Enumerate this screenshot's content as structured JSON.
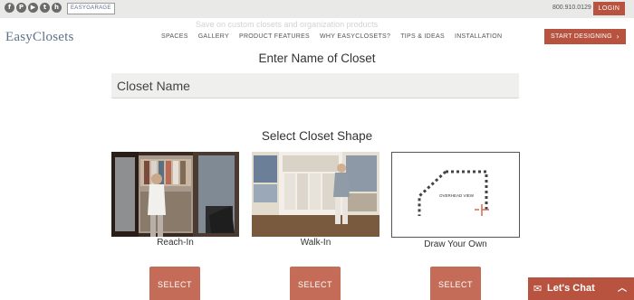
{
  "utility": {
    "social_icons": [
      {
        "name": "facebook-icon",
        "glyph": "f"
      },
      {
        "name": "pinterest-icon",
        "glyph": "P"
      },
      {
        "name": "youtube-icon",
        "glyph": "▶"
      },
      {
        "name": "twitter-icon",
        "glyph": "t"
      },
      {
        "name": "houzz-icon",
        "glyph": "h"
      }
    ],
    "garage_logo": "EASYGARAGE",
    "phone": "800.910.0129",
    "login_label": "LOGIN"
  },
  "promo": {
    "text": "Save on custom closets and organization products"
  },
  "header": {
    "logo": "EasyClosets",
    "nav_items": [
      "SPACES",
      "GALLERY",
      "PRODUCT FEATURES",
      "WHY EASYCLOSETS?",
      "TIPS & IDEAS",
      "INSTALLATION"
    ],
    "cta_label": "START DESIGNING",
    "cta_icon": "chevron-right-icon"
  },
  "form": {
    "name_heading": "Enter Name of Closet",
    "name_placeholder": "Closet Name",
    "shape_heading": "Select Closet Shape",
    "shapes": [
      {
        "label": "Reach-In",
        "select_label": "SELECT"
      },
      {
        "label": "Walk-In",
        "select_label": "SELECT"
      },
      {
        "label": "Draw Your Own",
        "select_label": "SELECT",
        "diagram_caption": "OVERHEAD VIEW"
      }
    ]
  },
  "chat": {
    "label": "Let's Chat",
    "icon": "chat-bubble-icon"
  },
  "colors": {
    "accent": "#b8533f",
    "select_button": "#c46c58",
    "topbar": "#e9e9e7",
    "input_bg": "#efefed",
    "logo": "#5d7288"
  }
}
